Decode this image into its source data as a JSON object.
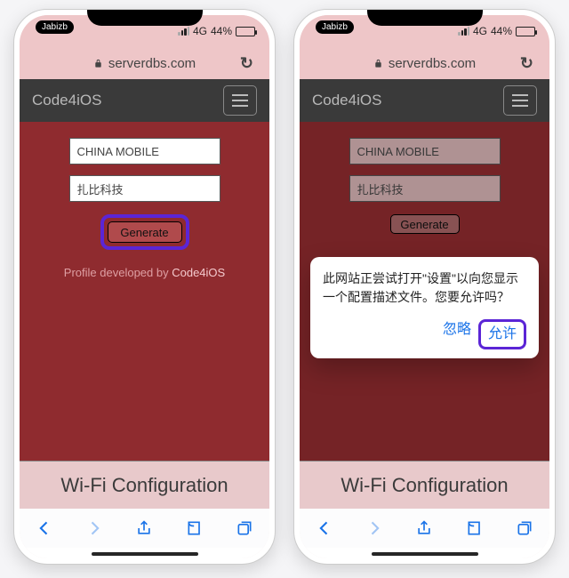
{
  "statusbar": {
    "badge": "Jabizb",
    "network": "4G",
    "battery": "44%",
    "battery_fill": "44%"
  },
  "urlbar": {
    "domain": "serverdbs.com"
  },
  "navbar": {
    "title": "Code4iOS"
  },
  "form": {
    "carrier_value": "CHINA MOBILE",
    "name_value": "扎比科技",
    "generate_label": "Generate"
  },
  "credit": {
    "prefix": "Profile developed by ",
    "link": "Code4iOS"
  },
  "footer": {
    "label": "Wi-Fi Configuration"
  },
  "dialog": {
    "message": "此网站正尝试打开\"设置\"以向您显示一个配置描述文件。您要允许吗？",
    "ignore": "忽略",
    "allow": "允许"
  }
}
